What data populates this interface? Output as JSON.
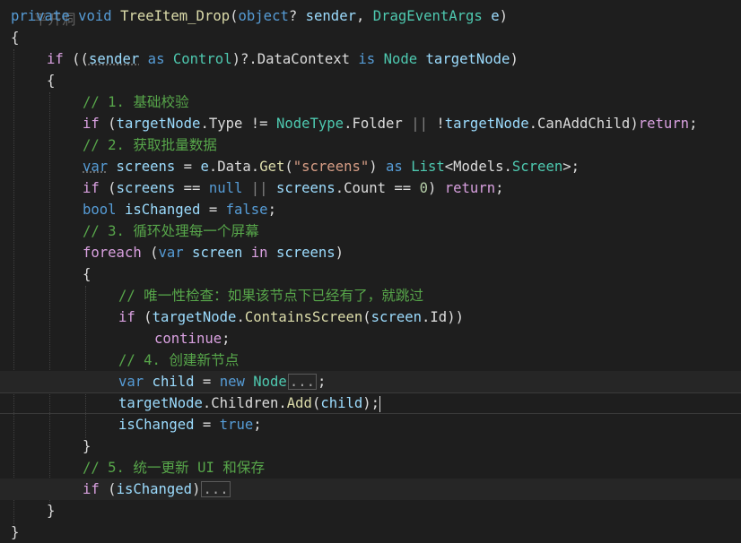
{
  "editor": {
    "top_fragment": "平开洞",
    "signature": {
      "modifier": "private",
      "return_type": "void",
      "method_name": "TreeItem_Drop",
      "open_paren": "(",
      "param1_type": "object",
      "param1_q": "?",
      "param1_name": " sender",
      "comma": ", ",
      "param2_type": "DragEventArgs",
      "param2_name": " e",
      "close_paren": ")"
    },
    "brace_open": "{",
    "brace_close": "}",
    "if_line": {
      "kw": "if",
      "text1": " ((",
      "sender": "sender",
      "as": " as ",
      "control": "Control",
      "text2": ")?.",
      "datacontext": "DataContext",
      "is": " is ",
      "node": "Node",
      "target": " targetNode",
      "text3": ")"
    },
    "inner_open": "{",
    "inner_close": "}",
    "comment1": "// 1. 基础校验",
    "check_line": {
      "kw": "if",
      "p1": " (",
      "tn": "targetNode",
      "dot1": ".",
      "prop_type": "Type",
      "neq": " != ",
      "nodetype": "NodeType",
      "dot2": ".",
      "folder": "Folder",
      "or": " || ",
      "not": "!",
      "tn2": "targetNode",
      "dot3": ".",
      "canadd": "CanAddChild",
      "p2": ")",
      "ret": "return",
      "semi": ";"
    },
    "comment2": "// 2. 获取批量数据",
    "var_line": {
      "kw": "var",
      "name": " screens",
      "eq": " = ",
      "e": "e",
      "dot1": ".",
      "data": "Data",
      "dot2": ".",
      "get": "Get",
      "p1": "(",
      "str": "\"screens\"",
      "p2": ")",
      "as": " as ",
      "list": "List",
      "lt": "<",
      "models": "Models",
      "dot3": ".",
      "screen": "Screen",
      "gt": ">;",
      "semi": ""
    },
    "null_line": {
      "kw": "if",
      "p1": " (",
      "screens": "screens",
      "eq": " == ",
      "null": "null",
      "or": " || ",
      "screens2": "screens",
      "dot": ".",
      "count": "Count",
      "eq2": " == ",
      "zero": "0",
      "p2": ") ",
      "ret": "return",
      "semi": ";"
    },
    "bool_line": {
      "kw": "bool",
      "name": " isChanged",
      "eq": " = ",
      "val": "false",
      "semi": ";"
    },
    "comment3": "// 3. 循环处理每一个屏幕",
    "foreach_line": {
      "kw": "foreach",
      "p1": " (",
      "var": "var",
      "screen": " screen",
      "in": " in",
      "screens": " screens",
      "p2": ")"
    },
    "loop_open": "{",
    "loop_close": "}",
    "comment4": "// 唯一性检查：如果该节点下已经有了，就跳过",
    "contains_line": {
      "kw": "if",
      "p1": " (",
      "tn": "targetNode",
      "dot": ".",
      "method": "ContainsScreen",
      "p2": "(",
      "screen": "screen",
      "dot2": ".",
      "id": "Id",
      "p3": "))"
    },
    "continue_kw": "continue",
    "continue_semi": ";",
    "comment5": "// 4. 创建新节点",
    "child_line": {
      "kw": "var",
      "name": " child",
      "eq": " = ",
      "new": "new",
      "sp": " ",
      "node": "Node",
      "fold": "...",
      "semi": ";"
    },
    "add_line": {
      "tn": "targetNode",
      "dot": ".",
      "children": "Children",
      "dot2": ".",
      "add": "Add",
      "p1": "(",
      "child": "child",
      "p2": ");"
    },
    "changed_line": {
      "name": "isChanged",
      "eq": " = ",
      "val": "true",
      "semi": ";"
    },
    "comment6": "// 5. 统一更新 UI 和保存",
    "final_if": {
      "kw": "if",
      "p1": " (",
      "name": "isChanged",
      "p2": ")",
      "fold": "..."
    }
  }
}
